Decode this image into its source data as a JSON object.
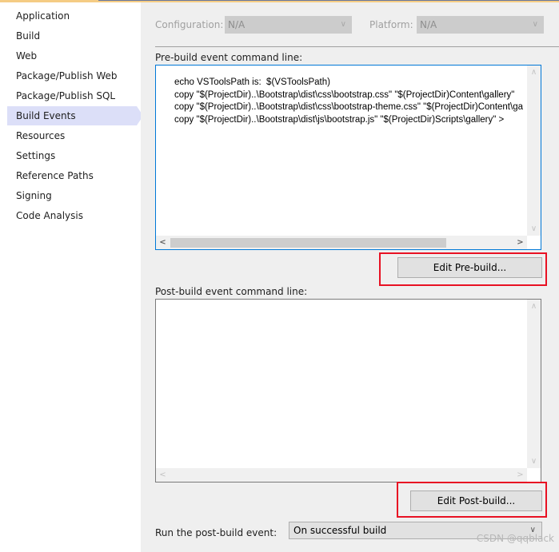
{
  "sidebar": {
    "items": [
      {
        "label": "Application"
      },
      {
        "label": "Build"
      },
      {
        "label": "Web"
      },
      {
        "label": "Package/Publish Web"
      },
      {
        "label": "Package/Publish SQL"
      },
      {
        "label": "Build Events",
        "active": true
      },
      {
        "label": "Resources"
      },
      {
        "label": "Settings"
      },
      {
        "label": "Reference Paths"
      },
      {
        "label": "Signing"
      },
      {
        "label": "Code Analysis"
      }
    ]
  },
  "config": {
    "configuration_label": "Configuration:",
    "configuration_value": "N/A",
    "platform_label": "Platform:",
    "platform_value": "N/A"
  },
  "prebuild": {
    "label": "Pre-build event command line:",
    "text": "echo VSToolsPath is:  $(VSToolsPath)\ncopy \"$(ProjectDir)..\\Bootstrap\\dist\\css\\bootstrap.css\" \"$(ProjectDir)Content\\gallery\"\ncopy \"$(ProjectDir)..\\Bootstrap\\dist\\css\\bootstrap-theme.css\" \"$(ProjectDir)Content\\gallery\"\ncopy \"$(ProjectDir)..\\Bootstrap\\dist\\js\\bootstrap.js\" \"$(ProjectDir)Scripts\\gallery\" >",
    "edit_button": "Edit Pre-build..."
  },
  "postbuild": {
    "label": "Post-build event command line:",
    "text": "",
    "edit_button": "Edit Post-build..."
  },
  "run_event": {
    "label": "Run the post-build event:",
    "value": "On successful build"
  },
  "icons": {
    "chevron_down": "∨",
    "chevron_up": "∧",
    "chevron_left": "<",
    "chevron_right": ">"
  },
  "watermark": "CSDN @qqblack",
  "colors": {
    "accent_focus": "#0078d7",
    "highlight_red": "#e81123",
    "active_nav": "#dcdff8"
  }
}
